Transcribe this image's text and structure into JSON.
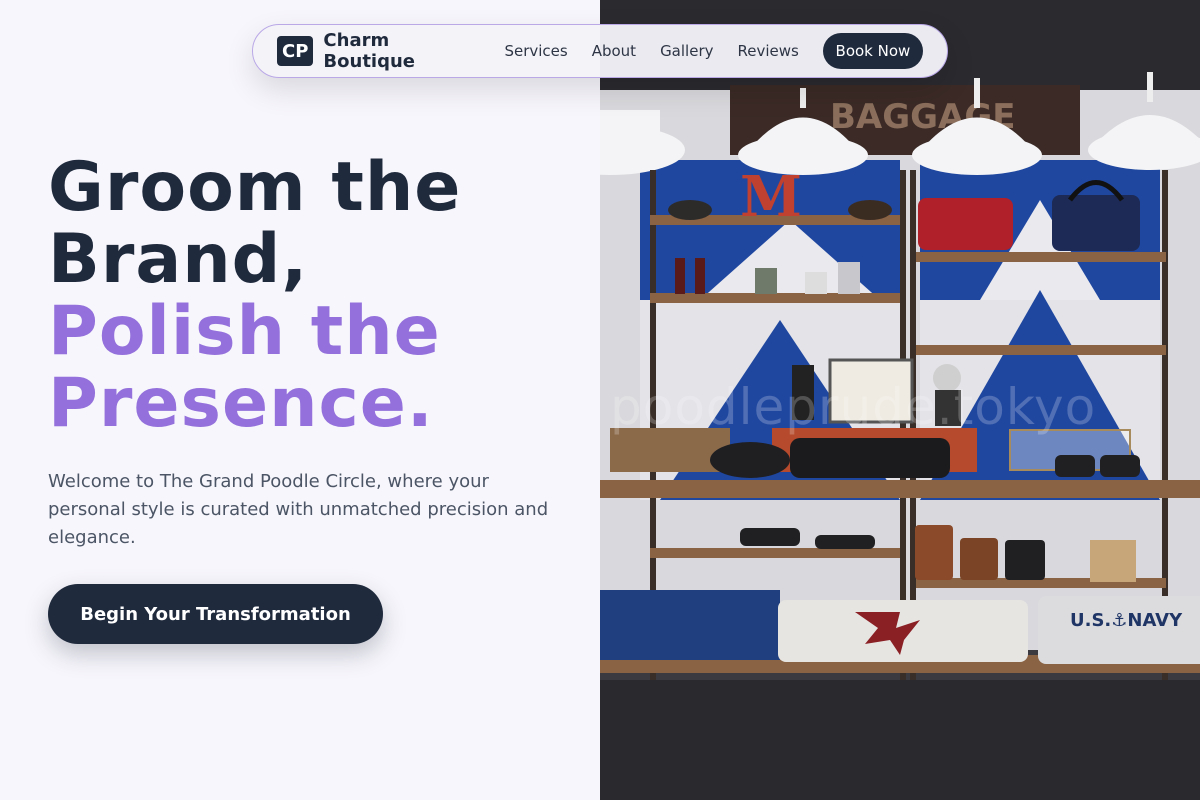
{
  "nav": {
    "logo_initials": "CP",
    "brand_name": "Charm Boutique",
    "links": [
      "Services",
      "About",
      "Gallery",
      "Reviews"
    ],
    "cta_label": "Book Now"
  },
  "hero": {
    "headline_line1": "Groom the",
    "headline_line2": "Brand,",
    "headline_line3": "Polish the",
    "headline_line4": "Presence.",
    "intro": "Welcome to The Grand Poodle Circle, where your personal style is curated with unmatched precision and elegance.",
    "cta_label": "Begin Your Transformation"
  },
  "photo": {
    "watermark": "poodleprude.tokyo",
    "sign_text": "BAGGAGE",
    "letter_sign": "M",
    "sweater_text": "U.S.⚓NAVY"
  },
  "colors": {
    "dark": "#1f2a3d",
    "accent": "#9370db",
    "background": "#f7f6fc",
    "body_text": "#4b5565"
  }
}
